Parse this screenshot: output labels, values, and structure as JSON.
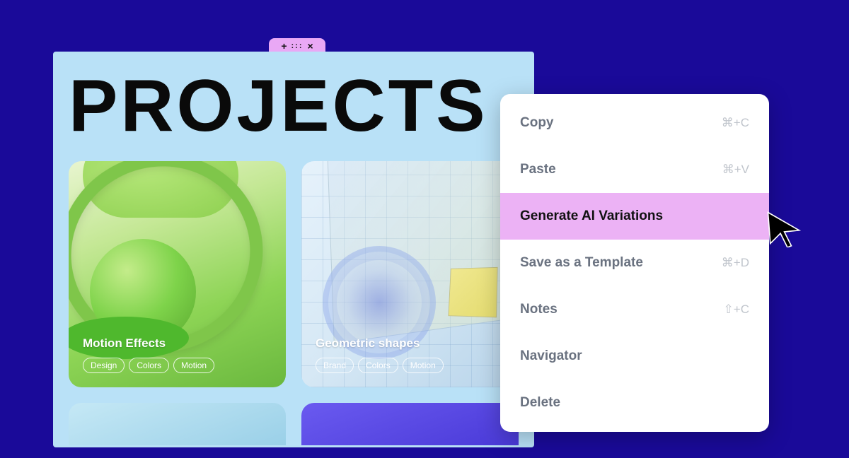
{
  "tab": {
    "plus": "+",
    "dots": ":::",
    "close": "×"
  },
  "page": {
    "title": "PROJECTS"
  },
  "cards": [
    {
      "title": "Motion Effects",
      "tags": [
        "Design",
        "Colors",
        "Motion"
      ]
    },
    {
      "title": "Geometric shapes",
      "tags": [
        "Brand",
        "Colors",
        "Motion"
      ]
    }
  ],
  "menu": {
    "items": [
      {
        "label": "Copy",
        "shortcut": "⌘+C",
        "highlighted": false
      },
      {
        "label": "Paste",
        "shortcut": "⌘+V",
        "highlighted": false
      },
      {
        "label": "Generate AI Variations",
        "shortcut": "",
        "highlighted": true
      },
      {
        "label": "Save as a Template",
        "shortcut": "⌘+D",
        "highlighted": false
      },
      {
        "label": "Notes",
        "shortcut": "⇧+C",
        "highlighted": false
      },
      {
        "label": "Navigator",
        "shortcut": "",
        "highlighted": false
      },
      {
        "label": "Delete",
        "shortcut": "",
        "highlighted": false
      }
    ]
  }
}
